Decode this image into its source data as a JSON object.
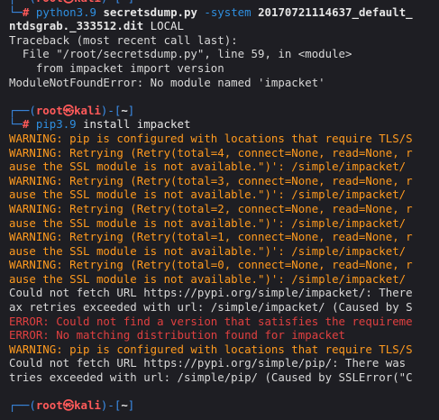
{
  "prompt": {
    "user": "root",
    "at": "㉿",
    "host": "kali",
    "cwd": "~",
    "hash": "#"
  },
  "block1": {
    "cmd": "python3.9",
    "arg1": "secretsdump.py",
    "arg2": "-system",
    "arg3": "20170721114637_default_",
    "line2_bold": "ntdsgrab._333512.dit",
    "line2_rest": " LOCAL",
    "out": [
      "Traceback (most recent call last):",
      "  File \"/root/secretsdump.py\", line 59, in <module>",
      "    from impacket import version",
      "ModuleNotFoundError: No module named 'impacket'"
    ]
  },
  "block2": {
    "cmd": "pip3.9",
    "args": " install impacket",
    "out": [
      {
        "t": "WARNING: pip is configured with locations that require TLS/S",
        "c": "warn"
      },
      {
        "t": "WARNING: Retrying (Retry(total=4, connect=None, read=None, r",
        "c": "warn"
      },
      {
        "t": "ause the SSL module is not available.\")': /simple/impacket/ ",
        "c": "warn"
      },
      {
        "t": "WARNING: Retrying (Retry(total=3, connect=None, read=None, r",
        "c": "warn"
      },
      {
        "t": "ause the SSL module is not available.\")': /simple/impacket/ ",
        "c": "warn"
      },
      {
        "t": "WARNING: Retrying (Retry(total=2, connect=None, read=None, r",
        "c": "warn"
      },
      {
        "t": "ause the SSL module is not available.\")': /simple/impacket/ ",
        "c": "warn"
      },
      {
        "t": "WARNING: Retrying (Retry(total=1, connect=None, read=None, r",
        "c": "warn"
      },
      {
        "t": "ause the SSL module is not available.\")': /simple/impacket/ ",
        "c": "warn"
      },
      {
        "t": "WARNING: Retrying (Retry(total=0, connect=None, read=None, r",
        "c": "warn"
      },
      {
        "t": "ause the SSL module is not available.\")': /simple/impacket/ ",
        "c": "warn"
      },
      {
        "t": "Could not fetch URL https://pypi.org/simple/impacket/: There",
        "c": "plain"
      },
      {
        "t": "ax retries exceeded with url: /simple/impacket/ (Caused by S",
        "c": "plain"
      },
      {
        "t": "ERROR: Could not find a version that satisfies the requireme",
        "c": "err"
      },
      {
        "t": "ERROR: No matching distribution found for impacket",
        "c": "err"
      },
      {
        "t": "WARNING: pip is configured with locations that require TLS/S",
        "c": "warn"
      },
      {
        "t": "Could not fetch URL https://pypi.org/simple/pip/: There was ",
        "c": "plain"
      },
      {
        "t": "tries exceeded with url: /simple/pip/ (Caused by SSLError(\"C",
        "c": "plain"
      }
    ]
  }
}
